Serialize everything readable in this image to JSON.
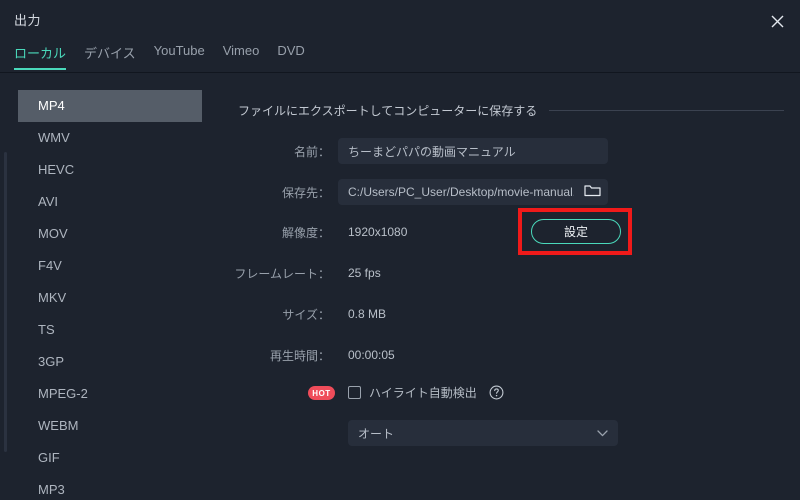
{
  "window": {
    "title": "出力",
    "close_icon": "close-icon"
  },
  "tabs": [
    {
      "label": "ローカル",
      "active": true
    },
    {
      "label": "デバイス",
      "active": false
    },
    {
      "label": "YouTube",
      "active": false
    },
    {
      "label": "Vimeo",
      "active": false
    },
    {
      "label": "DVD",
      "active": false
    }
  ],
  "sidebar": {
    "formats": [
      {
        "label": "MP4",
        "selected": true
      },
      {
        "label": "WMV",
        "selected": false
      },
      {
        "label": "HEVC",
        "selected": false
      },
      {
        "label": "AVI",
        "selected": false
      },
      {
        "label": "MOV",
        "selected": false
      },
      {
        "label": "F4V",
        "selected": false
      },
      {
        "label": "MKV",
        "selected": false
      },
      {
        "label": "TS",
        "selected": false
      },
      {
        "label": "3GP",
        "selected": false
      },
      {
        "label": "MPEG-2",
        "selected": false
      },
      {
        "label": "WEBM",
        "selected": false
      },
      {
        "label": "GIF",
        "selected": false
      },
      {
        "label": "MP3",
        "selected": false
      }
    ]
  },
  "main": {
    "section_title": "ファイルにエクスポートしてコンピューターに保存する",
    "fields": {
      "name_label": "名前：",
      "name_value": "ちーまどパパの動画マニュアル",
      "name_placeholder": "ちーまどパパの動画マニュアル",
      "path_label": "保存先：",
      "path_value": "C:/Users/PC_User/Desktop/movie-manual.f",
      "path_placeholder": "C:/Users/PC_User/Desktop/movie-manual.f",
      "resolution_label": "解像度：",
      "resolution_value": "1920x1080",
      "framerate_label": "フレームレート：",
      "framerate_value": "25 fps",
      "size_label": "サイズ：",
      "size_value": "0.8 MB",
      "duration_label": "再生時間：",
      "duration_value": "00:00:05"
    },
    "settings_button_label": "設定",
    "hot_badge_label": "HOT",
    "highlight_detect_label": "ハイライト自動検出",
    "auto_select_value": "オート",
    "folder_icon": "folder-icon",
    "help_icon": "help-circle-icon",
    "chevron_icon": "chevron-down-icon"
  },
  "colors": {
    "background": "#1d232e",
    "accent_teal": "#4ad9bb",
    "highlight_red": "#f01a1a",
    "badge_red": "#ef4c5a",
    "selected_row": "#555d68",
    "input_bg": "#272e3b"
  }
}
